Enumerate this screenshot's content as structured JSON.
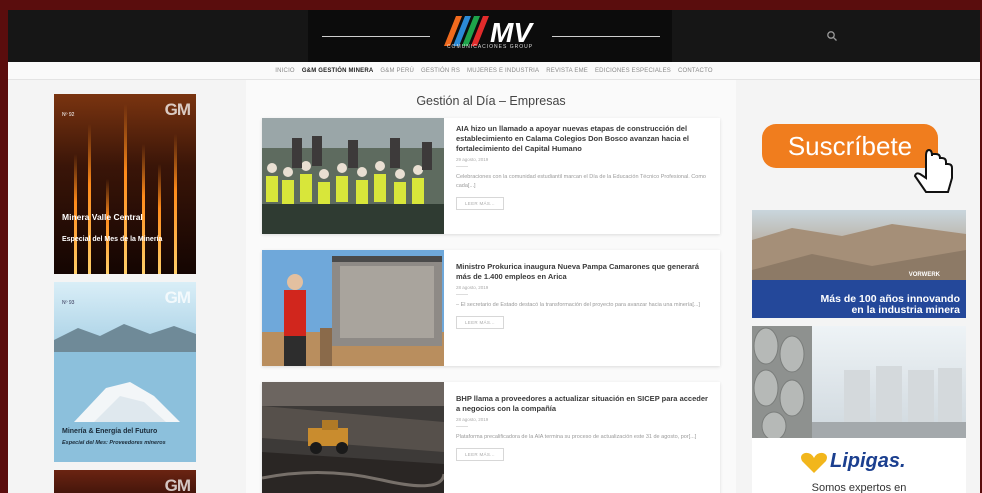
{
  "header": {
    "logo_text": "MV",
    "logo_sub": "COMUNICACIONES GROUP",
    "logo_colors": [
      "#f06a1e",
      "#2b8ad6",
      "#1ea34a",
      "#e22b2b"
    ]
  },
  "nav": {
    "items": [
      {
        "label": "INICIO",
        "active": false
      },
      {
        "label": "G&M GESTIÓN MINERA",
        "active": true
      },
      {
        "label": "G&M PERÚ",
        "active": false
      },
      {
        "label": "GESTIÓN RS",
        "active": false
      },
      {
        "label": "MUJERES E INDUSTRIA",
        "active": false
      },
      {
        "label": "REVISTA EME",
        "active": false
      },
      {
        "label": "EDICIONES ESPECIALES",
        "active": false
      },
      {
        "label": "CONTACTO",
        "active": false
      }
    ]
  },
  "magazines": {
    "m1": {
      "brand": "GM",
      "number": "Nº 92",
      "title": "Minera Valle Central",
      "subtitle": "Especial del Mes de la Minería"
    },
    "m2": {
      "brand": "GM",
      "number": "Nº 93",
      "title": "Minería & Energía del Futuro",
      "subtitle": "Especial del Mes: Proveedores mineros"
    },
    "m3": {
      "brand": "GM"
    }
  },
  "main": {
    "section_title": "Gestión al Día – Empresas",
    "articles": [
      {
        "title": "AIA hizo un llamado a apoyar nuevas etapas de construcción del establecimiento en Calama Colegios Don Bosco avanzan hacia el fortalecimiento del Capital Humano",
        "date": "29 agosto, 2019",
        "excerpt": "Celebraciones con la comunidad estudiantil marcan el Día de la Educación Técnico Profesional. Como cada[...]",
        "button": "LEER MÁS..."
      },
      {
        "title": "Ministro Prokurica inaugura Nueva Pampa Camarones que generará más de 1.400 empleos en Arica",
        "date": "28 agosto, 2019",
        "excerpt": "– El secretario de Estado destacó la transformación del proyecto para avanzar hacia una minería[...]",
        "button": "LEER MÁS..."
      },
      {
        "title": "BHP llama a proveedores a actualizar situación en SICEP para acceder a negocios con la compañía",
        "date": "28 agosto, 2019",
        "excerpt": "Plataforma precalificadora de la AIA termina su proceso de actualización este 31 de agosto, por[...]",
        "button": "LEER MÁS..."
      }
    ]
  },
  "sidebar": {
    "subscribe_label": "Suscríbete",
    "vorwerk": {
      "brand": "VORWERK",
      "line1": "Más de 100 años innovando",
      "line2": "en la industria minera"
    },
    "lipigas": {
      "brand": "Lipigas.",
      "tagline": "Somos expertos en"
    }
  }
}
